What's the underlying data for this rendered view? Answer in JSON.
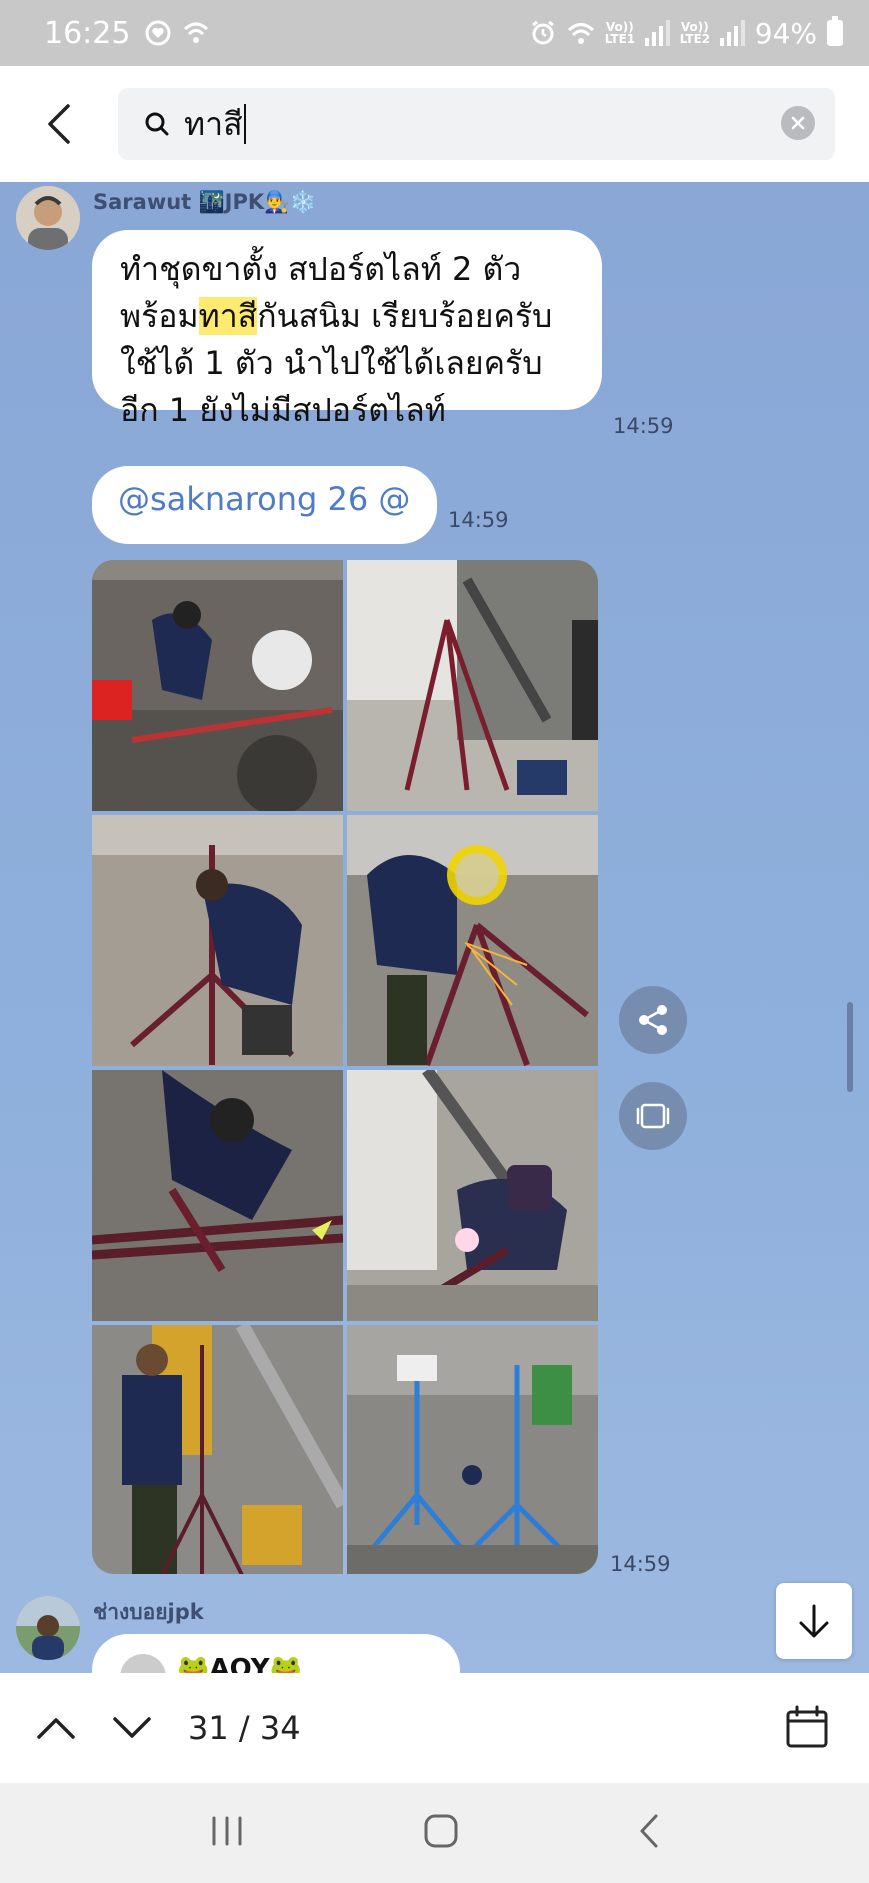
{
  "status_bar": {
    "time": "16:25",
    "net1": "Vo)) LTE1",
    "net2": "Vo)) LTE2",
    "battery": "94%"
  },
  "search": {
    "query": "ทาสี"
  },
  "messages": {
    "sender1": "Sarawut 🌃JPK👨‍🔧❄️",
    "msg1_before": "ทำชุดขาตั้ง สปอร์ตไลท์ 2 ตัว\nพร้อม",
    "msg1_highlight": "ทาสี",
    "msg1_after": "กันสนิม เรียบร้อยครับ\nใช้ได้ 1 ตัว นำไปใช้ได้เลยครับ\n อีก 1 ยังไม่มีสปอร์ตไลท์",
    "msg1_time": "14:59",
    "msg2_text": "@saknarong 26 @",
    "msg2_time": "14:59",
    "photos_time": "14:59",
    "sender2": "ช่างบอยjpk",
    "msg3_preview": "🐸AOY🐸"
  },
  "search_nav": {
    "result_count": "31 / 34"
  },
  "colors": {
    "chat_bg": "#8eaad6",
    "highlight": "#ffea70",
    "mention": "#4f7cc6"
  }
}
